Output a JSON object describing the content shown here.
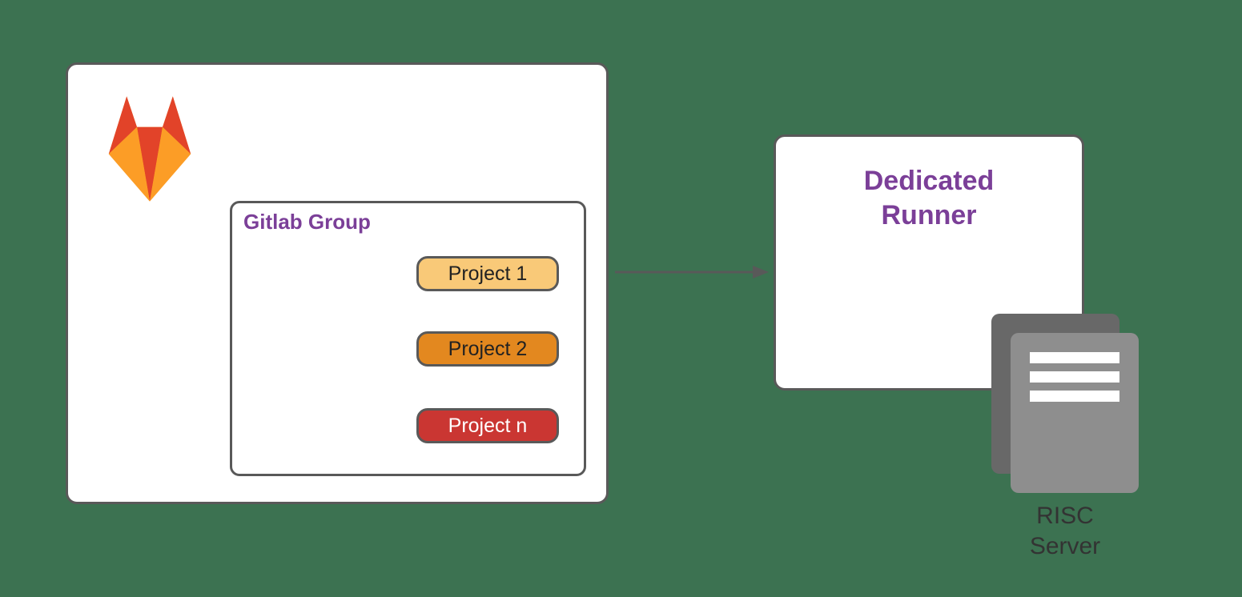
{
  "gitlab": {
    "group_title": "Gitlab Group",
    "projects": {
      "p1": "Project 1",
      "p2": "Project 2",
      "pn": "Project n"
    }
  },
  "runner": {
    "title_line1": "Dedicated",
    "title_line2": "Runner"
  },
  "server": {
    "label_line1": "RISC",
    "label_line2": "Server"
  },
  "colors": {
    "background": "#3c7251",
    "border": "#595959",
    "purple": "#7b3f98",
    "p1": "#f9c978",
    "p2": "#e3881f",
    "pn": "#ca3632"
  }
}
